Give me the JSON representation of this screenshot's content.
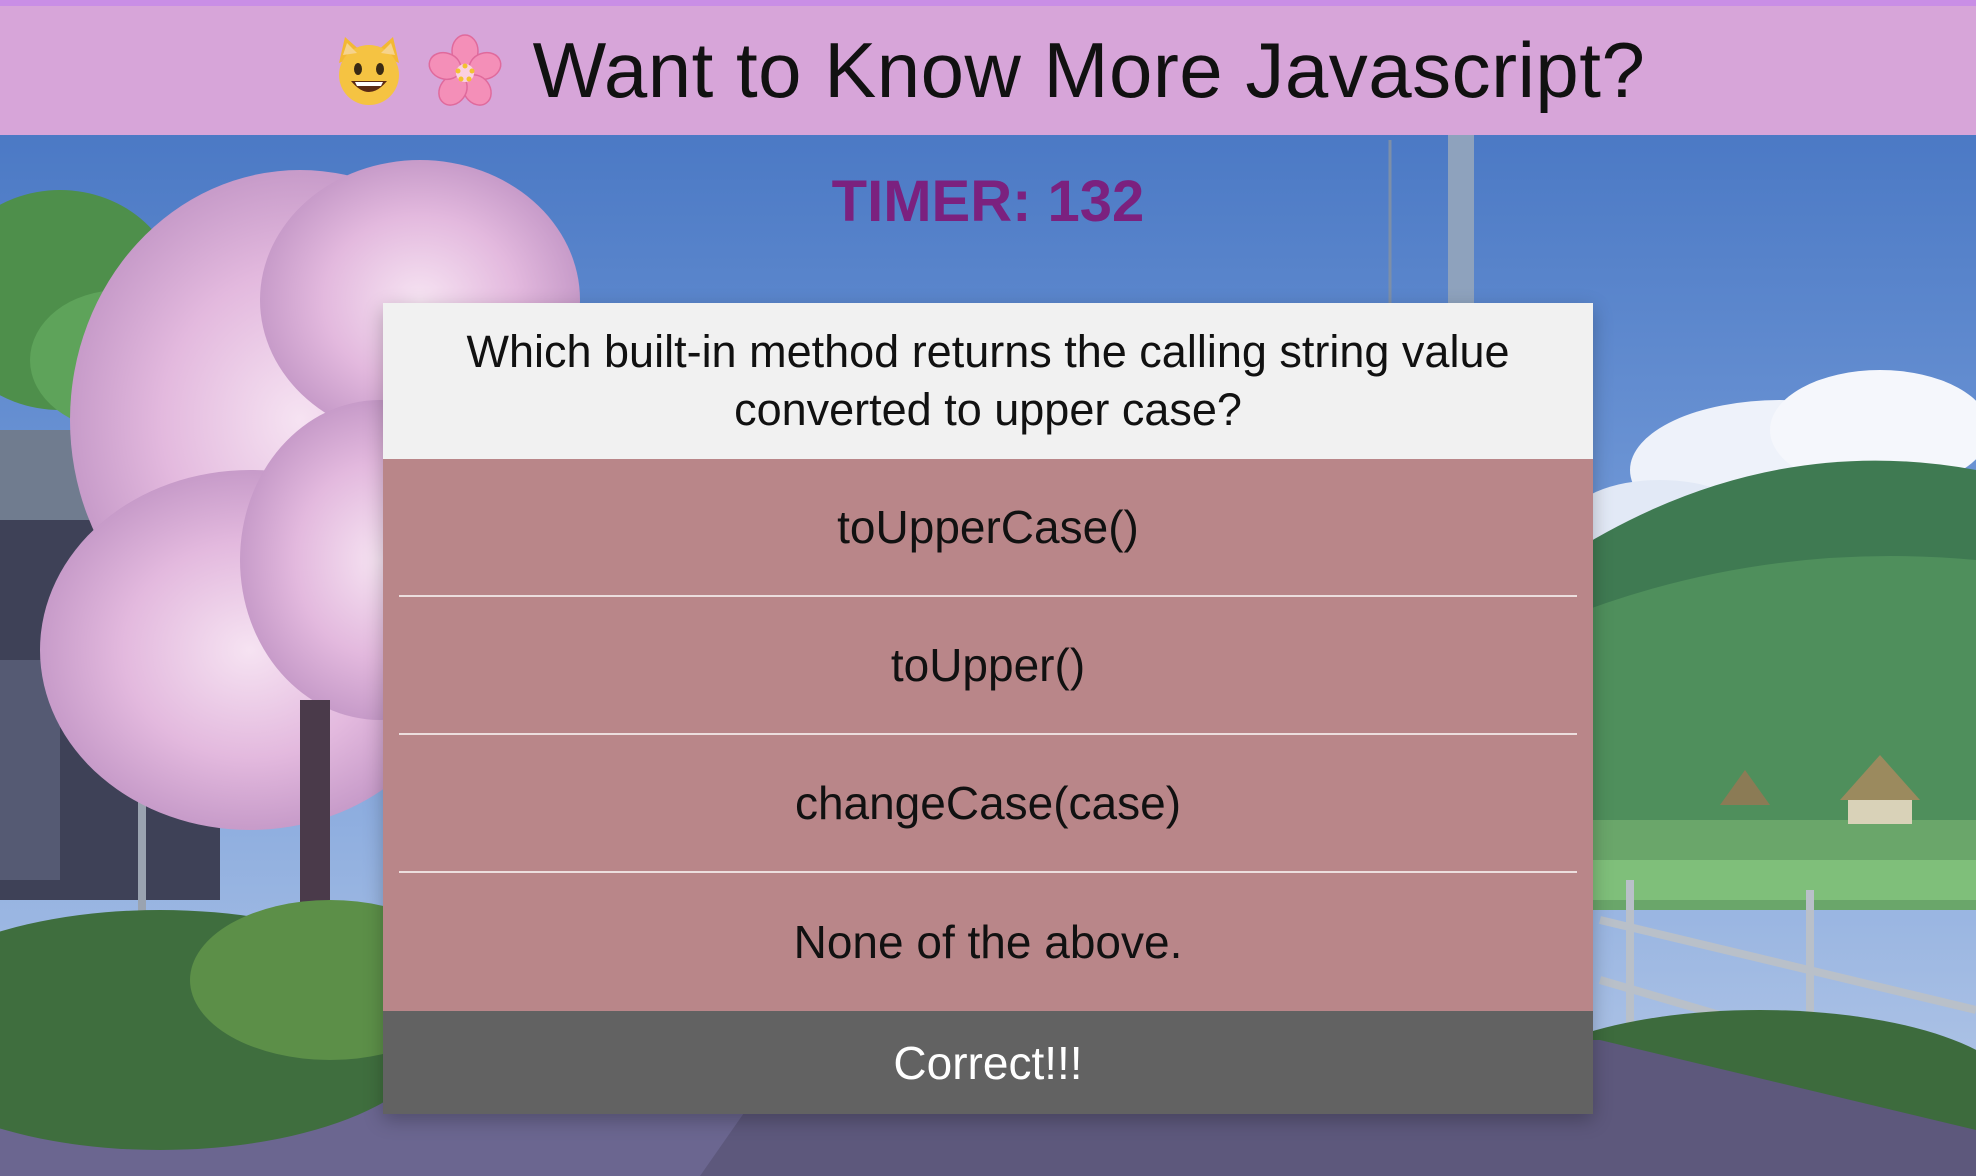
{
  "header": {
    "title": "Want to Know More Javascript?",
    "icons": [
      "grinning-cat-emoji",
      "cherry-blossom-emoji"
    ]
  },
  "timer": {
    "label": "TIMER: 132",
    "value": 132
  },
  "quiz": {
    "question": "Which built-in method returns the calling string value converted to upper case?",
    "choices": [
      "toUpperCase()",
      "toUpper()",
      "changeCase(case)",
      "None of the above."
    ],
    "feedback": "Correct!!!"
  },
  "colors": {
    "header_bg": "#d7a5d9",
    "timer_text": "#7b217f",
    "question_bg": "#f1f1f1",
    "choice_bg": "#b98689",
    "feedback_bg": "#626262"
  }
}
